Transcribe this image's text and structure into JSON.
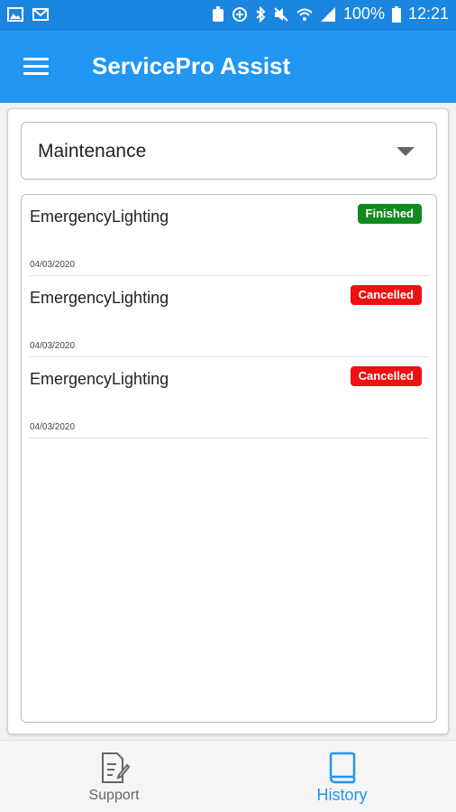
{
  "status_bar": {
    "battery_text": "100%",
    "time": "12:21",
    "icons": [
      "image-icon",
      "gmail-icon",
      "android-icon",
      "data-saver-icon",
      "bluetooth-icon",
      "mute-icon",
      "wifi-icon",
      "signal-icon",
      "battery-icon"
    ]
  },
  "app_bar": {
    "title": "ServicePro Assist",
    "menu_icon": "hamburger-icon"
  },
  "filter": {
    "selected": "Maintenance"
  },
  "history_items": [
    {
      "title": "EmergencyLighting",
      "date": "04/03/2020",
      "status": "Finished"
    },
    {
      "title": "EmergencyLighting",
      "date": "04/03/2020",
      "status": "Cancelled"
    },
    {
      "title": "EmergencyLighting",
      "date": "04/03/2020",
      "status": "Cancelled"
    }
  ],
  "bottom_nav": {
    "support_label": "Support",
    "history_label": "History",
    "active": "History"
  },
  "colors": {
    "primary": "#2196f3",
    "status_bar": "#1a86df",
    "finished": "#118a1e",
    "cancelled": "#ee1111"
  }
}
